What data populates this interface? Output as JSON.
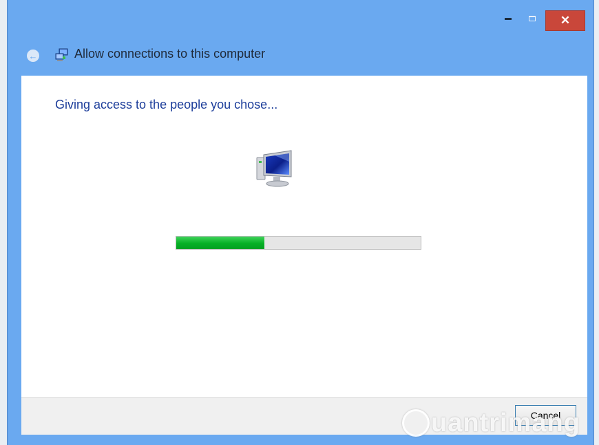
{
  "window": {
    "title": "Allow connections to this computer",
    "controls": {
      "close_glyph": "✕",
      "back_glyph": "←"
    }
  },
  "content": {
    "heading": "Giving access to the people you chose...",
    "progress": {
      "value_percent": 36
    },
    "icon": "computer-icon"
  },
  "footer": {
    "cancel_label": "Cancel"
  },
  "watermark": {
    "text": "uantrimang"
  },
  "colors": {
    "titlebar": "#6aa9f0",
    "heading": "#1c3d9a",
    "progress_fill": "#06b025",
    "close_button": "#c9473a"
  }
}
